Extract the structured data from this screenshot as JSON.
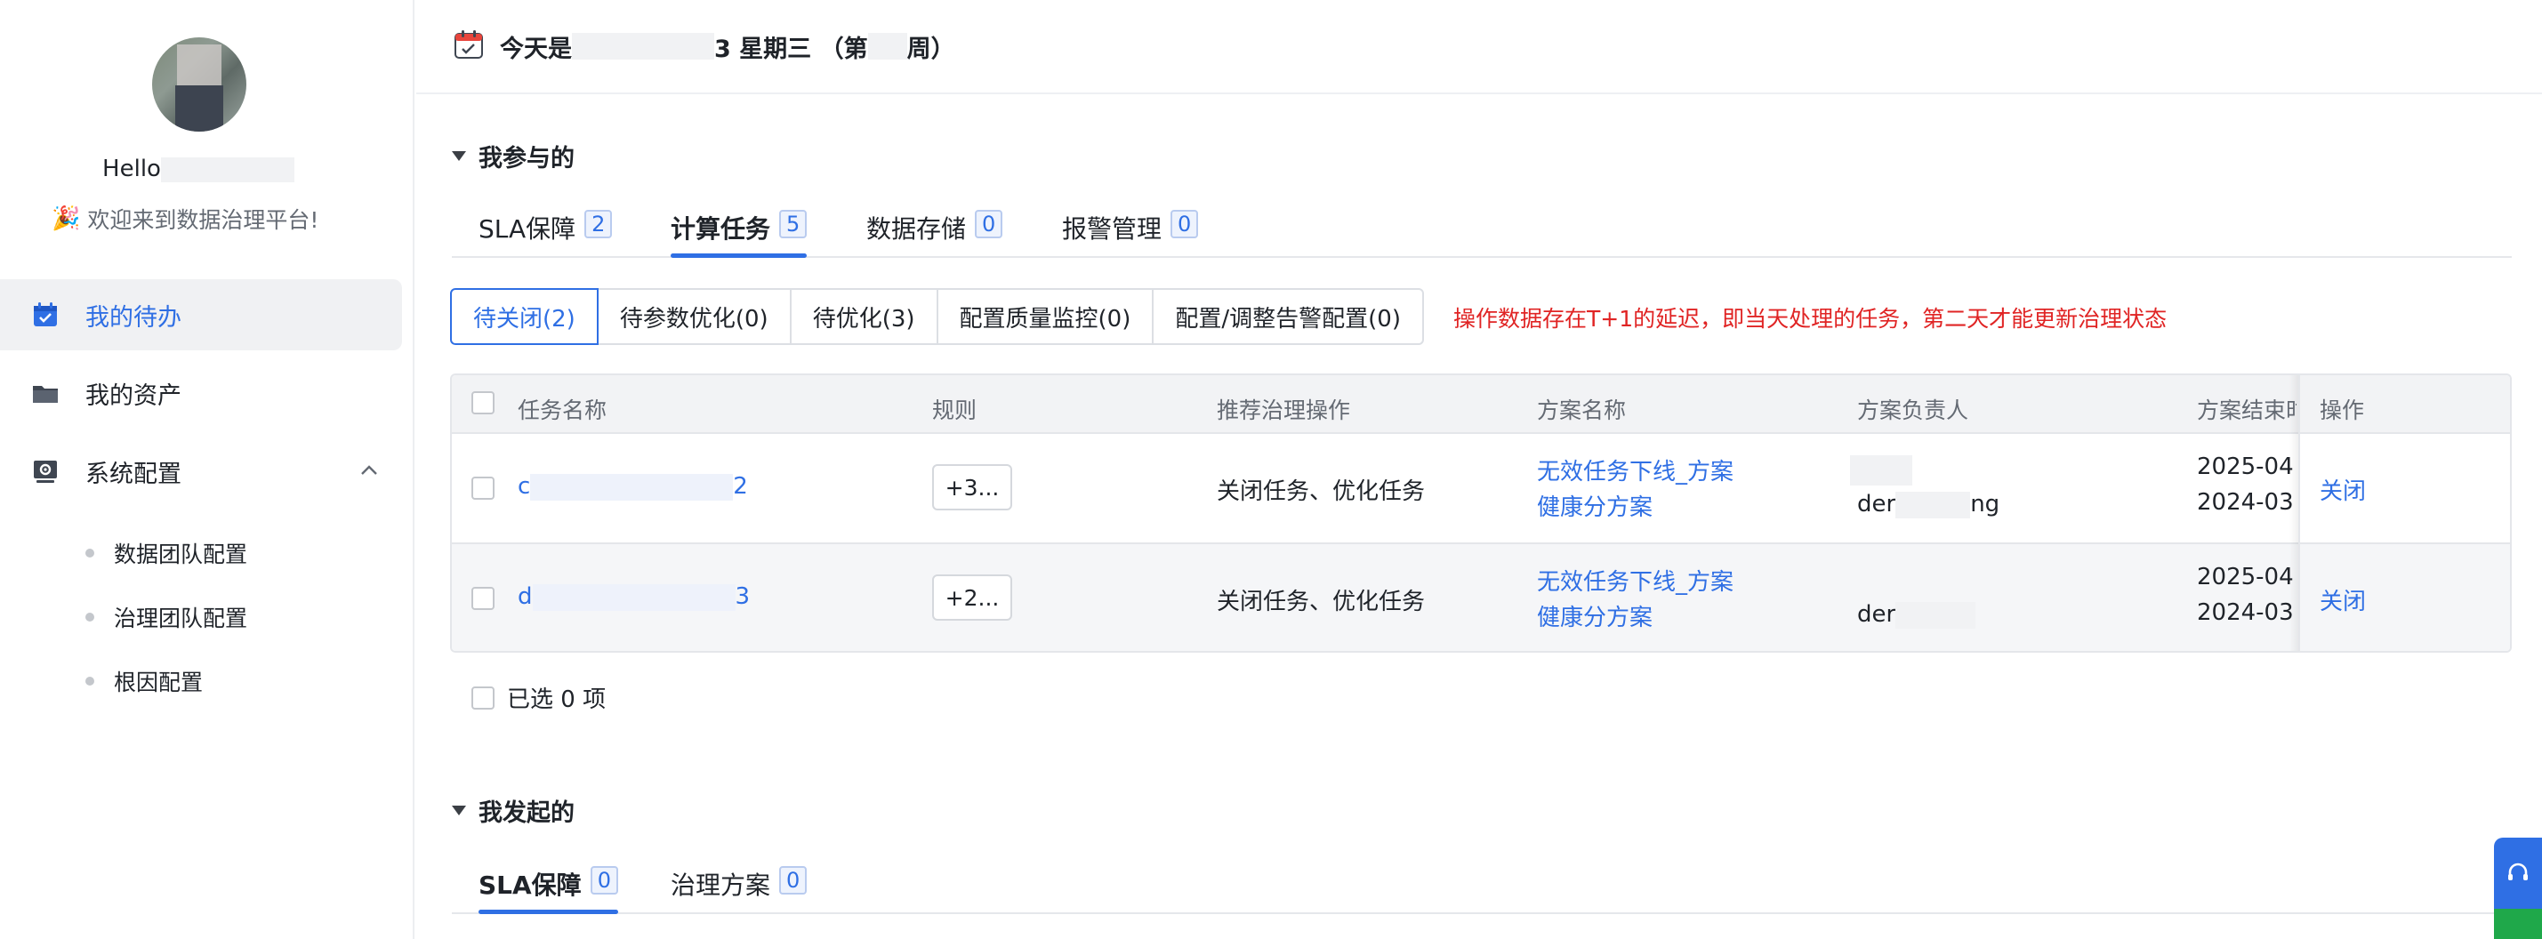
{
  "sidebar": {
    "hello": "Hello",
    "welcome": "欢迎来到数据治理平台!",
    "nav": [
      {
        "label": "我的待办",
        "icon": "calendar-check-icon"
      },
      {
        "label": "我的资产",
        "icon": "folder-icon"
      },
      {
        "label": "系统配置",
        "icon": "settings-monitor-icon"
      }
    ],
    "sub": [
      "数据团队配置",
      "治理团队配置",
      "根因配置"
    ]
  },
  "topbar": {
    "prefix": "今天是",
    "suffix_a": "3 星期三 （第",
    "suffix_b": "周）"
  },
  "participated": {
    "title": "我参与的",
    "tabs": [
      {
        "label": "SLA保障",
        "count": "2"
      },
      {
        "label": "计算任务",
        "count": "5"
      },
      {
        "label": "数据存储",
        "count": "0"
      },
      {
        "label": "报警管理",
        "count": "0"
      }
    ],
    "filters": [
      "待关闭(2)",
      "待参数优化(0)",
      "待优化(3)",
      "配置质量监控(0)",
      "配置/调整告警配置(0)"
    ],
    "notice": "操作数据存在T+1的延迟，即当天处理的任务，第二天才能更新治理状态",
    "table": {
      "headers": [
        "任务名称",
        "规则",
        "推荐治理操作",
        "方案名称",
        "方案负责人",
        "方案结束时",
        "操作"
      ],
      "rows": [
        {
          "task_start": "c",
          "task_end": "2",
          "rule": "+3...",
          "action": "关闭任务、优化任务",
          "plan1": "无效任务下线_方案",
          "plan2": "健康分方案",
          "owner_a": "der",
          "owner_b": "ng",
          "end1": "2025-04",
          "end2": "2024-03",
          "op": "关闭"
        },
        {
          "task_start": "d",
          "task_end": "3",
          "rule": "+2...",
          "action": "关闭任务、优化任务",
          "plan1": "无效任务下线_方案",
          "plan2": "健康分方案",
          "owner_a": "der",
          "owner_b": "",
          "end1": "2025-04",
          "end2": "2024-03",
          "op": "关闭"
        }
      ]
    },
    "selected": "已选 0 项"
  },
  "initiated": {
    "title": "我发起的",
    "tabs": [
      {
        "label": "SLA保障",
        "count": "0"
      },
      {
        "label": "治理方案",
        "count": "0"
      }
    ]
  },
  "colors": {
    "accent": "#2f6fe4",
    "warning": "#e02424",
    "float_green": "#1fa84a"
  }
}
